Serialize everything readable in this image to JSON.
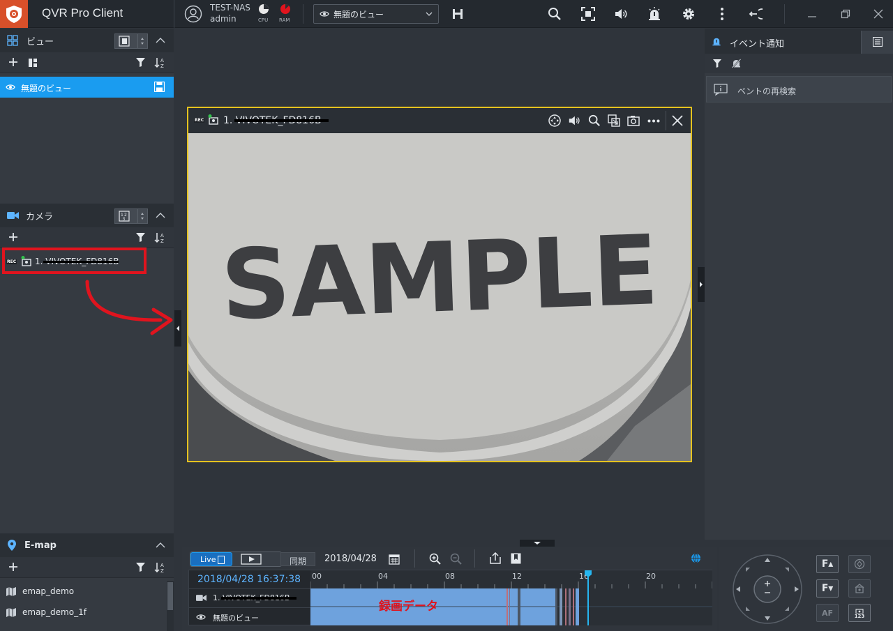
{
  "titlebar": {
    "app_title": "QVR Pro Client",
    "nas_name": "TEST-NAS",
    "user_name": "admin",
    "cpu_label": "CPU",
    "ram_label": "RAM",
    "view_select_value": "無題のビュー"
  },
  "left": {
    "view_section": {
      "title": "ビュー",
      "item_label": "無題のビュー"
    },
    "camera_section": {
      "title": "カメラ",
      "camera_label": "1. VIVOTEK_FD816B",
      "rec_badge": "REC"
    },
    "emap_section": {
      "title": "E-map",
      "items": [
        "emap_demo",
        "emap_demo_1f"
      ]
    }
  },
  "video": {
    "camera_title": "1. VIVOTEK_FD816B",
    "rec_badge": "REC",
    "sample_text": "SAMPLE"
  },
  "right": {
    "title": "イベント通知",
    "search_label": "ベントの再検索"
  },
  "bottom": {
    "live_label": "Live",
    "sync_label": "同期",
    "date": "2018/04/28",
    "current_time": "2018/04/28 16:37:38",
    "hours": [
      "00",
      "04",
      "08",
      "12",
      "16",
      "20"
    ],
    "row_camera": "1. VIVOTEK_FD816B",
    "row_view": "無題のビュー",
    "recording_label": "録画データ"
  },
  "ptz": {
    "focus_up": "F▴",
    "focus_down": "F▾",
    "af": "AF",
    "preset": "123"
  },
  "colors": {
    "accent_blue": "#1a9cf0",
    "logo": "#d8502a",
    "frame_yellow": "#e5c21f",
    "annotation_red": "#e0141e",
    "timeline_cursor": "#26b6f0"
  }
}
